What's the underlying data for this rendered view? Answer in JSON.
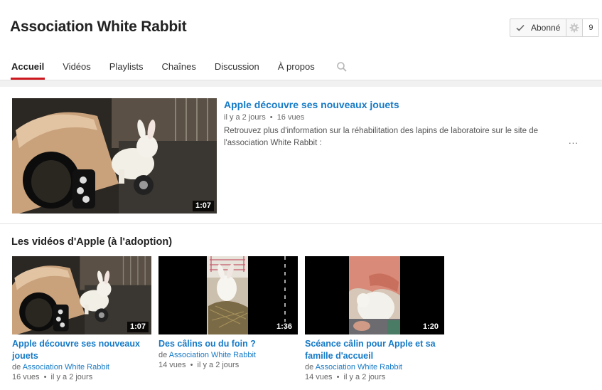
{
  "channel": {
    "title": "Association White Rabbit",
    "subscribe_label": "Abonné",
    "subscriber_count": "9"
  },
  "tabs": [
    "Accueil",
    "Vidéos",
    "Playlists",
    "Chaînes",
    "Discussion",
    "À propos"
  ],
  "icons": {
    "check": "check-icon",
    "gear": "gear-icon",
    "search": "search-icon"
  },
  "featured": {
    "title": "Apple découvre ses nouveaux jouets",
    "age": "il y a 2 jours",
    "views": "16 vues",
    "separator": "•",
    "description": "Retrouvez plus d'information sur la réhabilitation des lapins de laboratoire sur le site de l'association White Rabbit :",
    "more": "...",
    "duration": "1:07"
  },
  "shelf": {
    "title": "Les vidéos d'Apple (à l'adoption)",
    "by_prefix": "de",
    "videos": [
      {
        "title": "Apple découvre ses nouveaux jouets",
        "channel": "Association White Rabbit",
        "views": "16 vues",
        "age": "il y a 2 jours",
        "duration": "1:07"
      },
      {
        "title": "Des câlins ou du foin ?",
        "channel": "Association White Rabbit",
        "views": "14 vues",
        "age": "il y a 2 jours",
        "duration": "1:36"
      },
      {
        "title": "Scéance câlin pour Apple et sa famille d'accueil",
        "channel": "Association White Rabbit",
        "views": "14 vues",
        "age": "il y a 2 jours",
        "duration": "1:20"
      }
    ]
  },
  "colors": {
    "link": "#167ac6",
    "active_tab": "#cc181e",
    "background": "#f1f1f1"
  }
}
